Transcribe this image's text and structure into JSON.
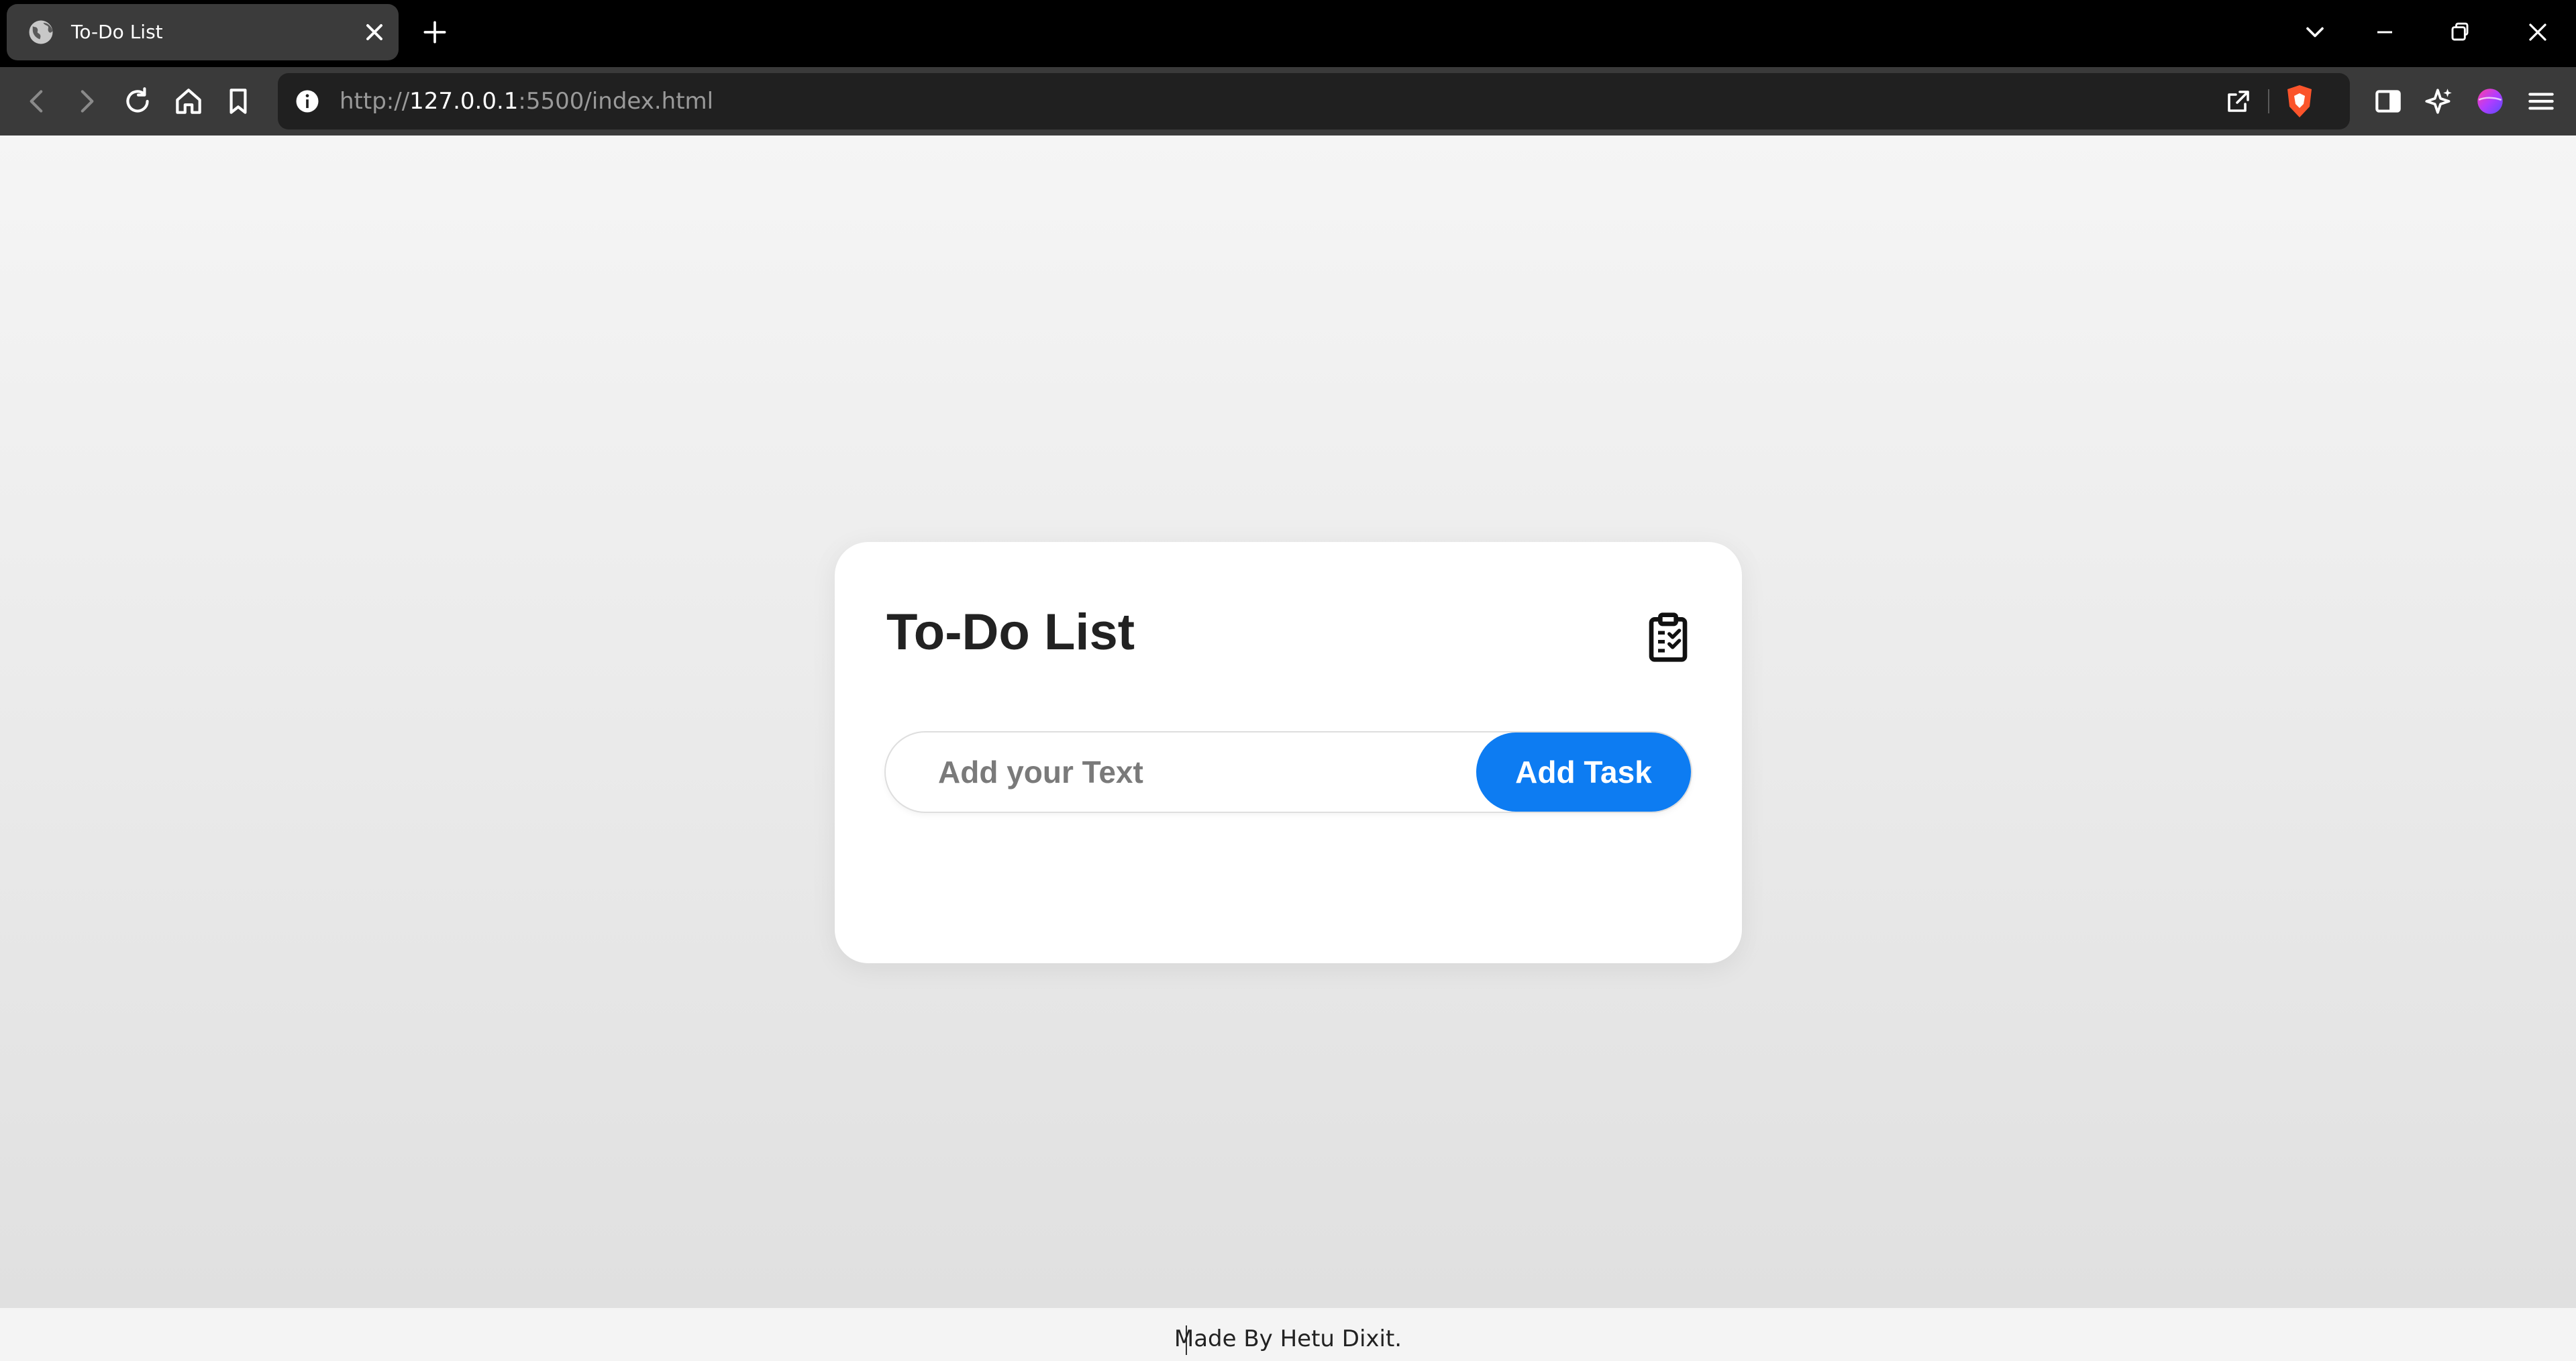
{
  "browser": {
    "tab": {
      "title": "To-Do List",
      "favicon": "globe-icon"
    },
    "address": {
      "scheme": "http://",
      "host": "127.0.0.1",
      "rest": ":5500/index.html"
    },
    "toolbar_icons": [
      "back-icon",
      "forward-icon",
      "reload-icon",
      "home-icon",
      "bookmark-icon",
      "site-info-icon",
      "share-icon",
      "brave-shields-icon",
      "sidebar-icon",
      "leo-ai-icon",
      "profile-avatar",
      "menu-icon"
    ],
    "window_controls": [
      "tab-search-icon",
      "minimize-icon",
      "restore-icon",
      "close-icon"
    ],
    "colors": {
      "titlebar": "#000000",
      "tab": "#3b3b3b",
      "toolbar": "#3a3a3a",
      "urlbar": "#202020"
    }
  },
  "page": {
    "card": {
      "title": "To-Do List",
      "icon": "clipboard-icon"
    },
    "input": {
      "placeholder": "Add your Text",
      "value": ""
    },
    "add_button_label": "Add Task",
    "footer_text": "Made By Hetu Dixit.",
    "colors": {
      "accent": "#0d7cf2",
      "card": "#ffffff",
      "title": "#222222"
    }
  }
}
